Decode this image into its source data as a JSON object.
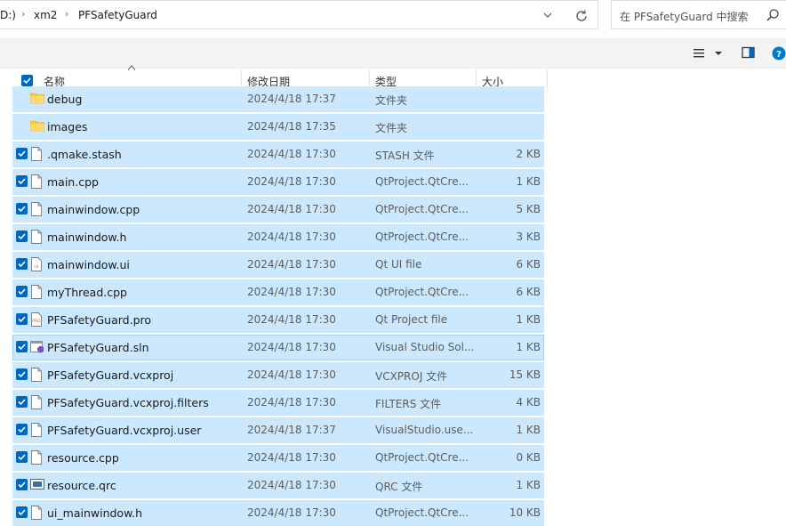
{
  "address": {
    "crumbs": [
      "D:)",
      "xm2",
      "PFSafetyGuard"
    ],
    "separator": "›"
  },
  "search": {
    "placeholder": "在 PFSafetyGuard 中搜索"
  },
  "header": {
    "name": "名称",
    "date": "修改日期",
    "type": "类型",
    "size": "大小"
  },
  "files": [
    {
      "name": "debug",
      "date": "2024/4/18 17:37",
      "type": "文件夹",
      "size": "",
      "icon": "folder-icon",
      "checked": false
    },
    {
      "name": "images",
      "date": "2024/4/18 17:35",
      "type": "文件夹",
      "size": "",
      "icon": "folder-icon",
      "checked": false
    },
    {
      "name": ".qmake.stash",
      "date": "2024/4/18 17:30",
      "type": "STASH 文件",
      "size": "2 KB",
      "icon": "file-icon",
      "checked": true
    },
    {
      "name": "main.cpp",
      "date": "2024/4/18 17:30",
      "type": "QtProject.QtCre...",
      "size": "1 KB",
      "icon": "file-icon",
      "checked": true
    },
    {
      "name": "mainwindow.cpp",
      "date": "2024/4/18 17:30",
      "type": "QtProject.QtCre...",
      "size": "5 KB",
      "icon": "file-icon",
      "checked": true
    },
    {
      "name": "mainwindow.h",
      "date": "2024/4/18 17:30",
      "type": "QtProject.QtCre...",
      "size": "3 KB",
      "icon": "file-icon",
      "checked": true
    },
    {
      "name": "mainwindow.ui",
      "date": "2024/4/18 17:30",
      "type": "Qt UI file",
      "size": "6 KB",
      "icon": "ui-file-icon",
      "checked": true
    },
    {
      "name": "myThread.cpp",
      "date": "2024/4/18 17:30",
      "type": "QtProject.QtCre...",
      "size": "6 KB",
      "icon": "file-icon",
      "checked": true
    },
    {
      "name": "PFSafetyGuard.pro",
      "date": "2024/4/18 17:30",
      "type": "Qt Project file",
      "size": "1 KB",
      "icon": "pro-file-icon",
      "checked": true
    },
    {
      "name": "PFSafetyGuard.sln",
      "date": "2024/4/18 17:30",
      "type": "Visual Studio Sol...",
      "size": "1 KB",
      "icon": "visual-studio-icon",
      "checked": true
    },
    {
      "name": "PFSafetyGuard.vcxproj",
      "date": "2024/4/18 17:30",
      "type": "VCXPROJ 文件",
      "size": "15 KB",
      "icon": "file-icon",
      "checked": true
    },
    {
      "name": "PFSafetyGuard.vcxproj.filters",
      "date": "2024/4/18 17:30",
      "type": "FILTERS 文件",
      "size": "4 KB",
      "icon": "file-icon",
      "checked": true
    },
    {
      "name": "PFSafetyGuard.vcxproj.user",
      "date": "2024/4/18 17:37",
      "type": "VisualStudio.use...",
      "size": "1 KB",
      "icon": "file-icon",
      "checked": true
    },
    {
      "name": "resource.cpp",
      "date": "2024/4/18 17:30",
      "type": "QtProject.QtCre...",
      "size": "0 KB",
      "icon": "file-icon",
      "checked": true
    },
    {
      "name": "resource.qrc",
      "date": "2024/4/18 17:30",
      "type": "QRC 文件",
      "size": "1 KB",
      "icon": "qrc-file-icon",
      "checked": true
    },
    {
      "name": "ui_mainwindow.h",
      "date": "2024/4/18 17:30",
      "type": "QtProject.QtCre...",
      "size": "10 KB",
      "icon": "file-icon",
      "checked": true
    }
  ],
  "colors": {
    "selection": "#cce8ff",
    "selection_border": "#99d1ff",
    "accent": "#0067c0"
  }
}
